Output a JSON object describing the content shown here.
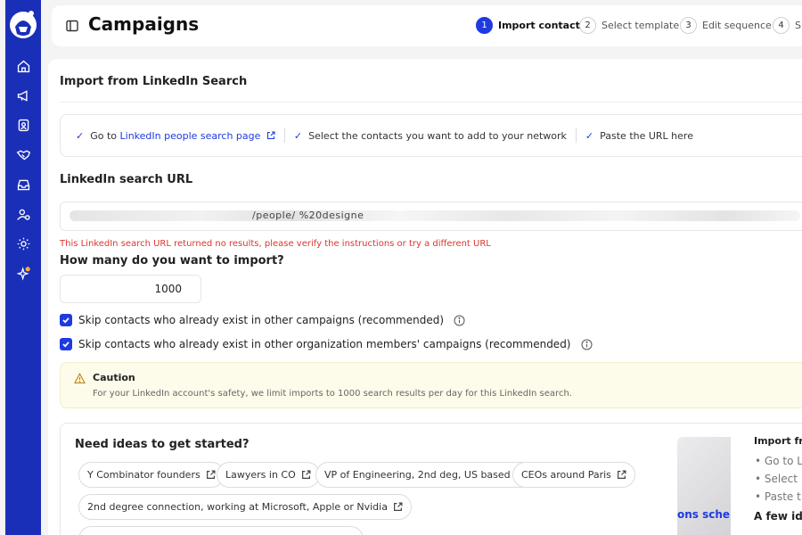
{
  "header": {
    "title": "Campaigns"
  },
  "steps": [
    {
      "num": "1",
      "label": "Import contacts",
      "active": true
    },
    {
      "num": "2",
      "label": "Select template"
    },
    {
      "num": "3",
      "label": "Edit sequence"
    },
    {
      "num": "4",
      "label": "S"
    }
  ],
  "import": {
    "section_title": "Import from LinkedIn Search",
    "instructions": {
      "step1_prefix": "Go to",
      "step1_link": "LinkedIn people search page",
      "step2": "Select the contacts you want to add to your network",
      "step3": "Paste the URL here"
    },
    "url_label": "LinkedIn search URL",
    "url_visible_fragment": "/people/                    %20designe",
    "url_error": "This LinkedIn search URL returned no results, please verify the instructions or try a different URL",
    "quantity_label": "How many do you want to import?",
    "quantity_value": "1000",
    "skip_campaigns": "Skip contacts who already exist in other campaigns (recommended)",
    "skip_org": "Skip contacts who already exist in other organization members' campaigns (recommended)"
  },
  "caution": {
    "title": "Caution",
    "text": "For your LinkedIn account's safety, we limit imports to 1000 search results per day for this LinkedIn search."
  },
  "ideas": {
    "title": "Need ideas to get started?",
    "chips": [
      "Y Combinator founders",
      "Lawyers in CO",
      "VP of Engineering, 2nd deg, US based",
      "CEOs around Paris",
      "2nd degree connection, working at Microsoft, Apple or Nvidia"
    ]
  },
  "preview": {
    "title": "Import fro",
    "items": [
      "Go to L",
      "Select",
      "Paste t"
    ],
    "sched": "ons sche",
    "ideas": "A few ide"
  },
  "colors": {
    "sidebar": "#1a2fb8",
    "accent": "#1e3ae0",
    "error": "#d9372f",
    "caution_bg": "#fdfbe9"
  }
}
